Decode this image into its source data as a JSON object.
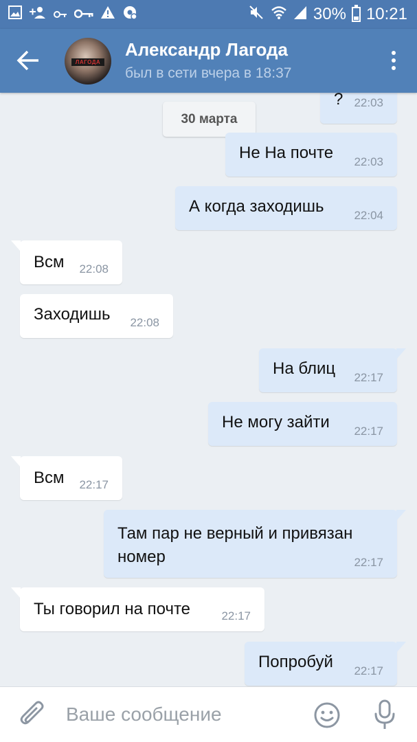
{
  "status_bar": {
    "left_icons": [
      "gallery-icon",
      "add-user-icon",
      "key-small-icon",
      "key-icon",
      "warning-icon",
      "settings-icon"
    ],
    "right_icons": [
      "mute-icon",
      "wifi-icon",
      "signal-icon"
    ],
    "battery": "30%",
    "time": "10:21"
  },
  "header": {
    "contact_name": "Александр Лагода",
    "last_seen": "был в сети вчера в 18:37",
    "avatar_caption": "ЛАГОДА",
    "icons": [
      "back-arrow-icon",
      "more-vertical-icon"
    ]
  },
  "messages": {
    "date_divider": "30 марта",
    "items": [
      {
        "dir": "out",
        "text": "?",
        "time": "22:03"
      },
      {
        "dir": "out",
        "text": "Не На почте",
        "time": "22:03"
      },
      {
        "dir": "out",
        "text": "А когда заходишь",
        "time": "22:04"
      },
      {
        "dir": "in",
        "text": "Всм",
        "time": "22:08"
      },
      {
        "dir": "in",
        "text": "Заходишь",
        "time": "22:08"
      },
      {
        "dir": "out",
        "text": "На блиц",
        "time": "22:17"
      },
      {
        "dir": "out",
        "text": "Не могу зайти",
        "time": "22:17"
      },
      {
        "dir": "in",
        "text": "Всм",
        "time": "22:17"
      },
      {
        "dir": "out",
        "text_line1": "Там пар не верный и привязан",
        "text_line2": "номер",
        "time": "22:17"
      },
      {
        "dir": "in",
        "text": "Ты говорил на почте",
        "time": "22:17"
      },
      {
        "dir": "out",
        "text": "Попробуй",
        "time": "22:17"
      }
    ]
  },
  "composer": {
    "placeholder": "Ваше сообщение",
    "icons": [
      "paperclip-icon",
      "emoji-icon",
      "microphone-icon"
    ]
  },
  "colors": {
    "header_bg": "#5181b8",
    "status_bar_bg": "#4d7ab2",
    "chat_bg": "#ebeff3",
    "outgoing_bubble": "#dce9f9",
    "incoming_bubble": "#ffffff"
  }
}
